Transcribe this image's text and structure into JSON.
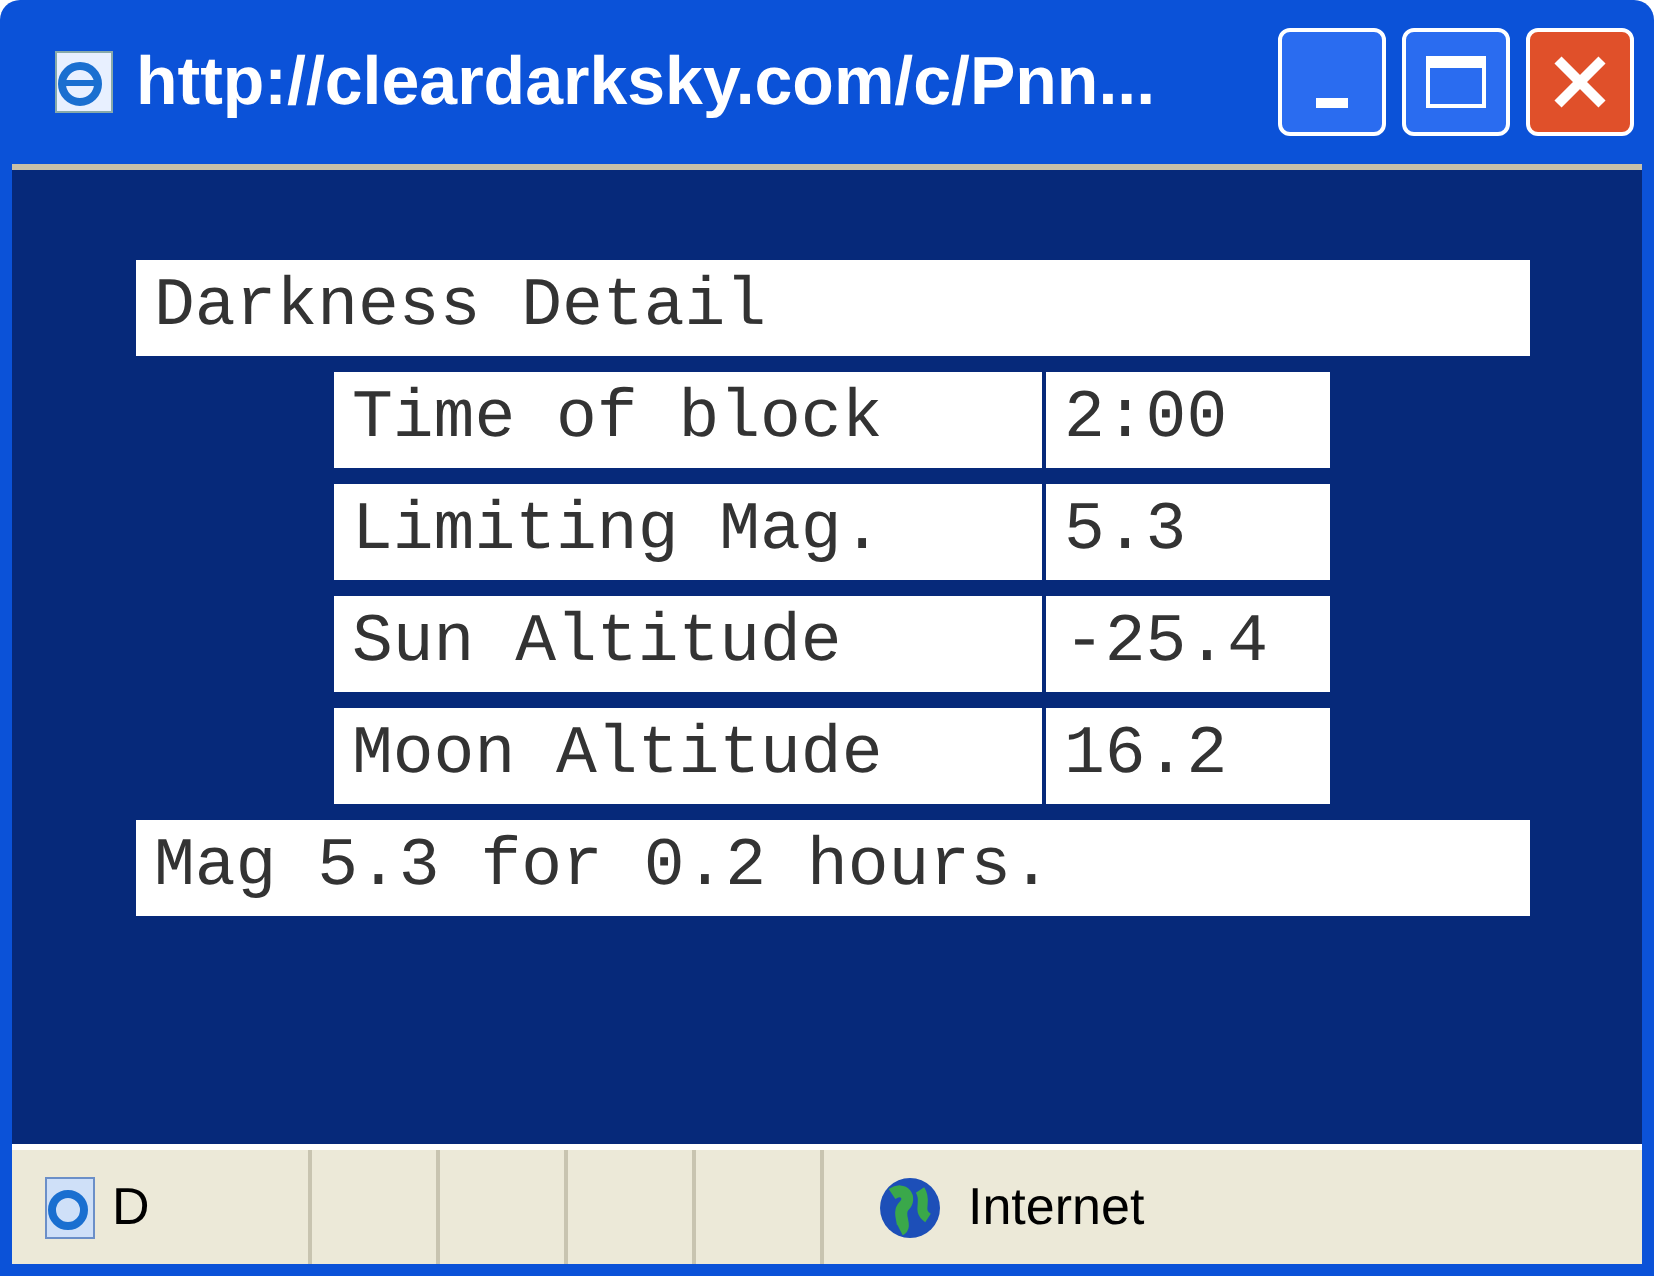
{
  "window": {
    "title": "http://cleardarksky.com/c/Pnn..."
  },
  "detail": {
    "heading": "Darkness Detail",
    "rows": [
      {
        "label": "Time of block",
        "value": "2:00"
      },
      {
        "label": "Limiting Mag.",
        "value": "5.3"
      },
      {
        "label": "Sun Altitude",
        "value": "-25.4"
      },
      {
        "label": "Moon Altitude",
        "value": "16.2"
      }
    ],
    "summary": "Mag 5.3 for 0.2 hours."
  },
  "status_bar": {
    "page_status": "D",
    "zone": "Internet"
  }
}
